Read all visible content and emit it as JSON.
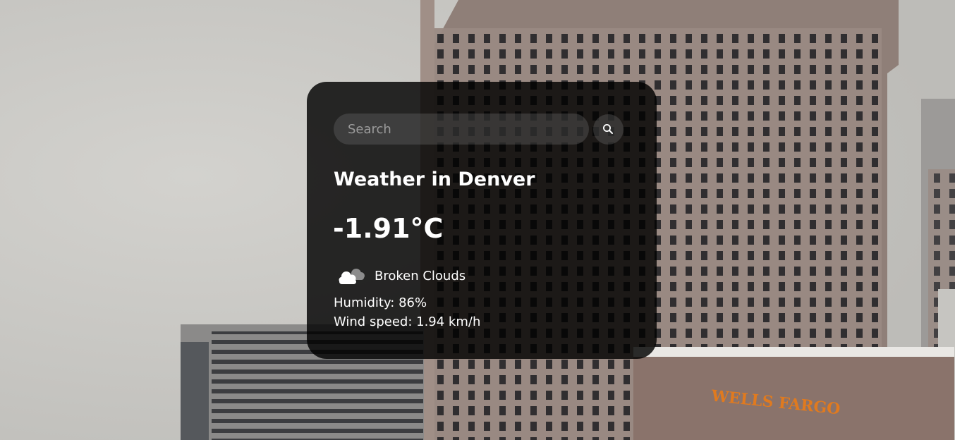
{
  "background": {
    "sign_text": "WELLS FARGO",
    "sign_color": "#e07a1f",
    "sky_color": "#c9c8c4",
    "building_color": "#8f7f78"
  },
  "search": {
    "placeholder": "Search",
    "value": "",
    "button_icon": "search-icon"
  },
  "weather": {
    "title": "Weather in Denver",
    "temperature": "-1.91°C",
    "icon": "broken-clouds-icon",
    "description": "Broken Clouds",
    "humidity": "Humidity: 86%",
    "wind": "Wind speed: 1.94 km/h"
  },
  "colors": {
    "card_bg": "#000000",
    "text": "#ffffff"
  }
}
